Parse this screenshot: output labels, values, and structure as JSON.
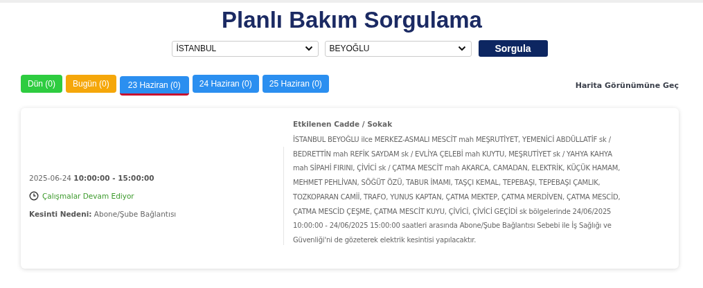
{
  "page_title": "Planlı Bakım Sorgulama",
  "filters": {
    "city": "İSTANBUL",
    "district": "BEYOĞLU",
    "button": "Sorgula"
  },
  "day_tabs": [
    {
      "label": "Dün (0)",
      "color": "#2ecc40",
      "selected": false
    },
    {
      "label": "Bugün (0)",
      "color": "#f5a70a",
      "selected": false
    },
    {
      "label": "23 Haziran (0)",
      "color": "#2b8ff0",
      "selected": true
    },
    {
      "label": "24 Haziran (0)",
      "color": "#2b8ff0",
      "selected": false
    },
    {
      "label": "25 Haziran (0)",
      "color": "#2b8ff0",
      "selected": false
    }
  ],
  "map_link": "Harita Görünümüne Geç",
  "outages": [
    {
      "time": "2025-06-24 **10:00:00 - 15:00:00**",
      "status": {
        "kind": "ongoing",
        "text": "Çalışmalar Devam Ediyor"
      },
      "reason": "**Kesinti Nedeni:** Abone/Şube Bağlantısı",
      "streets_heading": "Etkilenen Cadde / Sokak",
      "description": "İSTANBUL BEYOĞLU ilce MERKEZ-ASMALI MESCİT mah MEŞRUTİYET, YEMENİCİ ABDÜLLATİF sk / BEDRETTİN mah REFİK SAYDAM sk / EVLİYA ÇELEBİ mah KUYTU, MEŞRUTİYET sk / YAHYA KAHYA mah SİPAHİ FIRINI, ÇİVİCİ sk / ÇATMA MESCİT mah AKARCA, CAMADAN, ELEKTRİK, KÜÇÜK HAMAM, MEHMET PEHLİVAN, SÖĞÜT ÖZÜ, TABUR İMAMI, TAŞÇI KEMAL, TEPEBAŞI, TEPEBAŞI ÇAMLIK, TOZKOPARAN CAMİİ, TRAFO, YUNUS KAPTAN, ÇATMA MEKTEP, ÇATMA MERDİVEN, ÇATMA MESCİD, ÇATMA MESCİD ÇEŞME, ÇATMA MESCİT KUYU, ÇİVİCİ, ÇİVİCİ GEÇİDİ sk bölgelerinde 24/06/2025 10:00:00 - 24/06/2025 15:00:00 saatleri arasında Abone/Şube Bağlantısı Sebebi ile İş Sağlığı ve Güvenliği'ni de gözeterek elektrik kesintisi yapılacaktır."
    }
  ]
}
